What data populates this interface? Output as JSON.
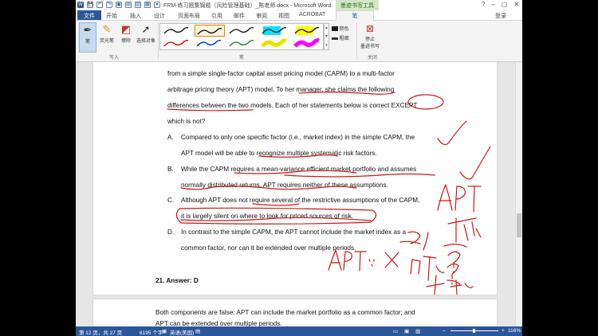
{
  "window": {
    "title": "FRM-练习题集锦题（风险管理基础）_陈老师.docx - Microsoft Word",
    "context_tab": "墨迹书写工具",
    "minimize": "?",
    "restore": "▢",
    "close": "✕",
    "qat": [
      "W",
      "💾",
      "↶",
      "↷",
      "▣",
      "▤",
      "▥",
      "▦",
      "▾"
    ]
  },
  "tabs": {
    "file": "文件",
    "items": [
      "开始",
      "插入",
      "设计",
      "页面布局",
      "引用",
      "邮件",
      "审阅",
      "视图",
      "ACROBAT",
      "笔"
    ],
    "login": "登录"
  },
  "ribbon": {
    "tools": {
      "pen": "笔",
      "highlighter": "荧光笔",
      "eraser": "擦除",
      "select": "选择对象"
    },
    "group_input": "写入",
    "group_pens": "笔",
    "color_label": "颜色",
    "thickness_label": "粗细",
    "stop_label_1": "停止",
    "stop_label_2": "墨迹书写",
    "pen_colors": [
      "#1a1a1a",
      "#1a1a1a",
      "#1a1a1a",
      "#1a1a1a",
      "#1a1a1a",
      "#e60000",
      "#0033cc",
      "#2d7a2d",
      "#e6e600",
      "#ff00ff",
      "#e60000",
      "#0033cc",
      "#2d7a2d",
      "#e6e600",
      "#ff00ff"
    ]
  },
  "document": {
    "lines": [
      "from a simple single-factor capital asset pricing model (CAPM) to a multi-factor",
      "arbitrage pricing theory (APT) model. To her manager, she claims the following",
      "differences between the two models. Each of her statements below is correct EXCEPT",
      "which is not?"
    ],
    "options": [
      {
        "letter": "A.",
        "line1": "Compared to only one specific factor (i.e., market index) in the simple CAPM, the",
        "line2": "APT model will be able to recognize multiple systematic risk factors."
      },
      {
        "letter": "B.",
        "line1": "While the CAPM requires a mean-variance efficient market portfolio and assumes",
        "line2": "normally distributed returns, APT requires neither of these assumptions."
      },
      {
        "letter": "C.",
        "line1": "Although APT does not require several of the restrictive assumptions of the CAPM,",
        "line2": "it is largely silent on where to look for priced sources of risk."
      },
      {
        "letter": "D.",
        "line1": "In contrast to the simple CAPM, the APT cannot include the market index as a",
        "line2": "common factor, nor can it be extended over multiple periods."
      }
    ],
    "answer": "21.  Answer: D",
    "explanation_1": "Both components are false: APT can include the market portfolio as a common factor; and",
    "explanation_2": "APT can be extended over multiple periods."
  },
  "status": {
    "page": "第 12 页，共 27 页",
    "words": "6195 个字",
    "lang": "英语(美国)",
    "zoom": "116%"
  }
}
